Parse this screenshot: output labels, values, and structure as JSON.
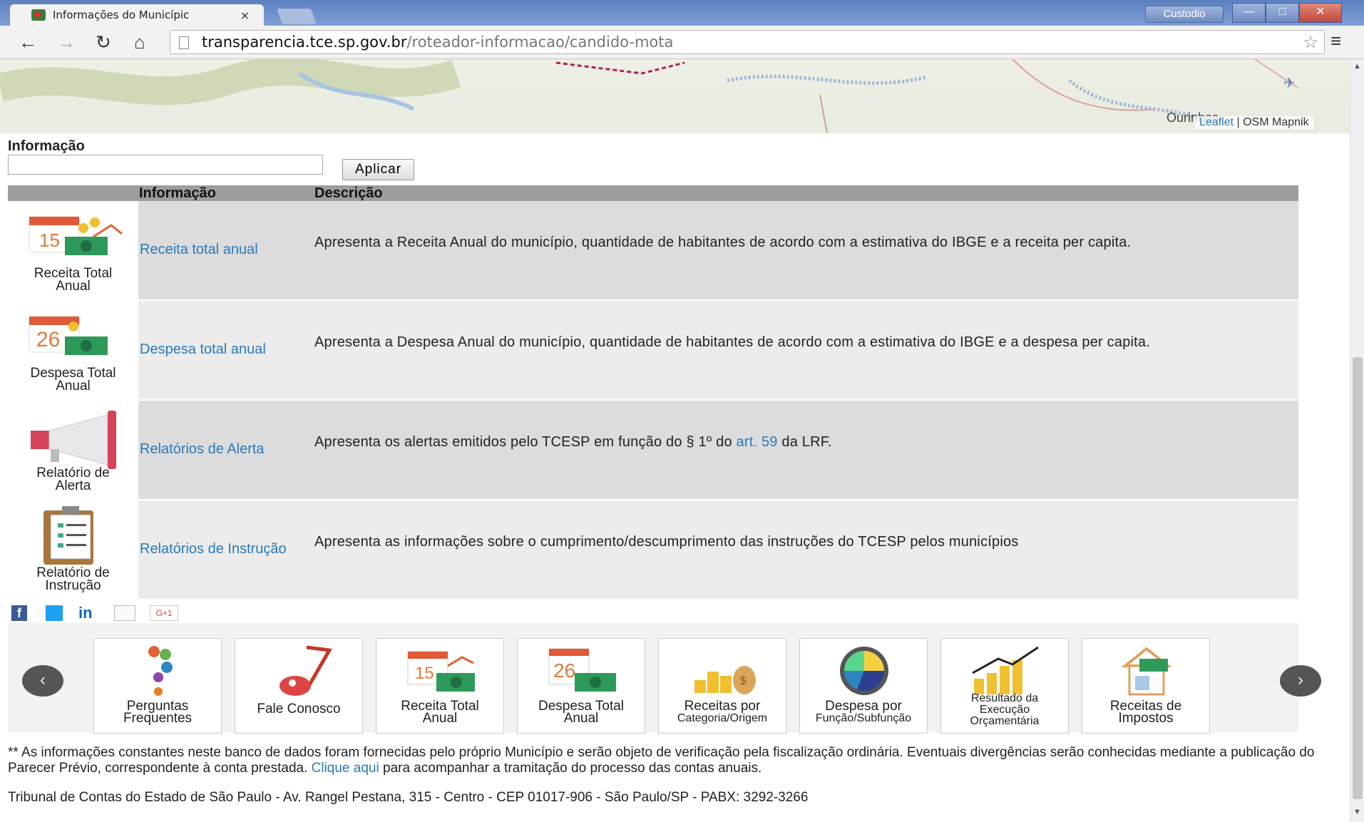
{
  "browser": {
    "tab_title": "Informações do Municípic",
    "tab_close": "×",
    "user_label": "Custodio",
    "url_domain": "transparencia.tce.sp.gov.br",
    "url_path": "/roteador-informacao/candido-mota",
    "window_min": "—",
    "window_max": "□",
    "window_close": "✕"
  },
  "map": {
    "place_label": "Ourinhos",
    "attribution_link": "Leaflet",
    "attribution_rest": " | OSM Mapnik"
  },
  "filter": {
    "label": "Informação",
    "input_value": "",
    "apply_label": "Aplicar"
  },
  "table": {
    "headers": {
      "info": "Informação",
      "desc": "Descrição"
    },
    "rows": [
      {
        "caption": [
          "Receita Total",
          "Anual"
        ],
        "link": "Receita total anual",
        "desc": "Apresenta a Receita Anual do município, quantidade de habitantes de acordo com a estimativa do IBGE e a receita per capita."
      },
      {
        "caption": [
          "Despesa Total",
          "Anual"
        ],
        "link": "Despesa total anual",
        "desc": "Apresenta a Despesa Anual do município, quantidade de habitantes de acordo com a estimativa do IBGE e a despesa per capita."
      },
      {
        "caption": [
          "Relatório de",
          "Alerta"
        ],
        "link": "Relatórios de Alerta",
        "desc_pre": "Apresenta os alertas emitidos pelo TCESP em função do § 1º do ",
        "desc_link": "art. 59",
        "desc_post": " da LRF."
      },
      {
        "caption": [
          "Relatório de",
          "Instrução"
        ],
        "link": "Relatórios de Instrução",
        "desc": "Apresenta as informações sobre o cumprimento/descumprimento das instruções do TCESP pelos municípios"
      }
    ]
  },
  "share": {
    "fb": "f",
    "li": "in",
    "gplus": "G+1"
  },
  "carousel": {
    "prev": "‹",
    "next": "›",
    "cards": [
      [
        "Perguntas",
        "Frequentes"
      ],
      [
        "Fale Conosco",
        ""
      ],
      [
        "Receita Total",
        "Anual"
      ],
      [
        "Despesa Total",
        "Anual"
      ],
      [
        "Receitas por",
        "Categoria/Origem"
      ],
      [
        "Despesa por",
        "Função/Subfunção"
      ],
      [
        "Resultado da",
        "Execução",
        "Orçamentária"
      ],
      [
        "Receitas de",
        "Impostos"
      ]
    ],
    "calendar_days": [
      "15",
      "26"
    ]
  },
  "footer": {
    "note_pre": "** As informações constantes neste banco de dados foram fornecidas pelo próprio Município e serão objeto de verificação pela fiscalização ordinária. Eventuais divergências serão conhecidas mediante a publicação do Parecer Prévio,  correspondente à conta prestada. ",
    "note_link": "Clique aqui",
    "note_post": " para acompanhar a tramitação do processo das contas anuais.",
    "address": "Tribunal de Contas do Estado de São Paulo - Av. Rangel Pestana, 315 - Centro - CEP 01017-906 - São Paulo/SP - PABX: 3292-3266"
  },
  "colors": {
    "link": "#2a7ab8",
    "header_bar": "#9d9d9d",
    "row_a": "#dcdcdc",
    "row_b": "#ececec"
  }
}
